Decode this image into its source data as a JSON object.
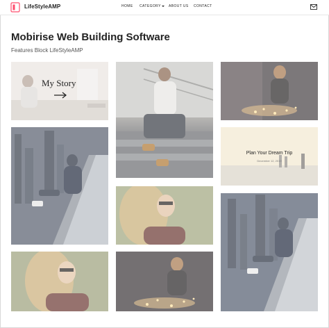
{
  "header": {
    "brand": "LifeStyleAMP",
    "nav": [
      {
        "label": "HOME"
      },
      {
        "label": "CATEGORY"
      },
      {
        "label": "ABOUT US"
      },
      {
        "label": "CONTACT"
      }
    ],
    "icons": {
      "logo": "brand-logo-icon",
      "mail": "mail-icon",
      "dropdown": "chevron-down-icon",
      "arrow": "arrow-right-icon"
    }
  },
  "page": {
    "title": "Mobirise Web Building Software",
    "subtitle": "Features Block LifeStyleAMP"
  },
  "tiles": {
    "story": {
      "label": "My Story"
    },
    "trip": {
      "title": "Plan Your Dream Trip",
      "date": "December 12, 2019"
    }
  },
  "colors": {
    "text": "#232323",
    "accent": "#ff4d6d",
    "border": "#d8d8d8"
  }
}
